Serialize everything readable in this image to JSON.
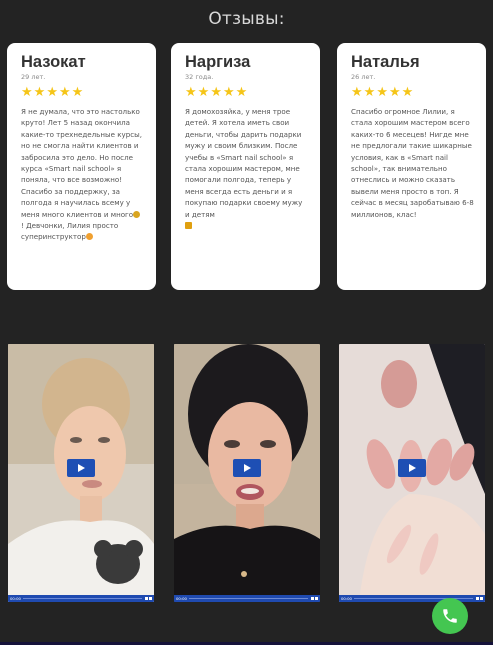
{
  "section": {
    "title": "Отзывы:"
  },
  "reviews": [
    {
      "name": "Назокат",
      "age": "29 лет.",
      "rating": 5,
      "text_1": "Я не думала, что это настолько круто! Лет 5 назад окончила какие-то трехнедельные курсы, но не смогла найти клиентов и забросила это дело. Но после курса «Smart nail school» я поняла, что все возможно! Спасибо за поддержку, за полгода я научилась всему у меня много клиентов и много",
      "text_2": "! Девчонки, Лилия просто суперинструктор"
    },
    {
      "name": "Наргиза",
      "age": "32 года.",
      "rating": 5,
      "text_1": "Я домохозяйка, у меня трое детей. Я хотела иметь свои деньги, чтобы дарить подарки мужу и своим близким. После учебы в «Smart nail school» я стала хорошим мастером, мне помогали полгода, теперь у меня всегда есть деньги и я покупаю подарки своему мужу и детям"
    },
    {
      "name": "Наталья",
      "age": "26 лет.",
      "rating": 5,
      "text_1": "Спасибо огромное Лилии, я стала хорошим мастером всего каких-то 6 месецев! Нигде мне не предлогали такие шикарные условия, как в «Smart nail school», так внимательно отнеслись и можно сказать вывели меня просто в топ. Я сейчас в месяц заробатываю 6-8 миллионов, клас!"
    }
  ],
  "videos": [
    {
      "time": "00:00",
      "subject": "woman-blonde"
    },
    {
      "time": "00:00",
      "subject": "woman-dark-hair"
    },
    {
      "time": "00:00",
      "subject": "nails-closeup"
    }
  ],
  "colors": {
    "background": "#232323",
    "card": "#ffffff",
    "star": "#f5c518",
    "play_button": "#1e4fb4",
    "phone_button": "#44c651"
  }
}
